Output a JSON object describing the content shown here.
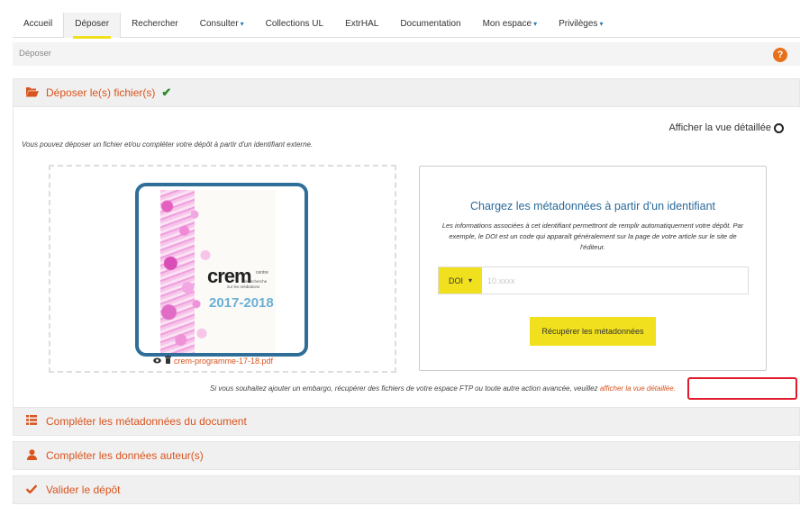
{
  "nav": {
    "items": [
      {
        "label": "Accueil",
        "dropdown": false,
        "active": false
      },
      {
        "label": "Déposer",
        "dropdown": false,
        "active": true
      },
      {
        "label": "Rechercher",
        "dropdown": false,
        "active": false
      },
      {
        "label": "Consulter",
        "dropdown": true,
        "active": false
      },
      {
        "label": "Collections UL",
        "dropdown": false,
        "active": false
      },
      {
        "label": "ExtrHAL",
        "dropdown": false,
        "active": false
      },
      {
        "label": "Documentation",
        "dropdown": false,
        "active": false
      },
      {
        "label": "Mon espace",
        "dropdown": true,
        "active": false
      },
      {
        "label": "Privilèges",
        "dropdown": true,
        "active": false
      }
    ],
    "caret": "▾"
  },
  "breadcrumb": {
    "label": "Déposer",
    "help": "?"
  },
  "deposit_section": {
    "title": "Déposer le(s) fichier(s)",
    "icon": "folder-open-icon",
    "check": "✔",
    "detail_toggle": "Afficher la vue détaillée",
    "intro": "Vous pouvez déposer un fichier et/ou compléter votre dépôt à partir d'un identifiant externe.",
    "file": {
      "name": "crem-programme-17-18.pdf",
      "cover_title": "crem",
      "cover_sub1": "centre",
      "cover_sub2": "de recherche",
      "cover_sub3": "sur les médiations",
      "cover_years": "2017-2018"
    },
    "metadata": {
      "title": "Chargez les métadonnées à partir d'un identifiant",
      "description": "Les informations associées à cet identifiant permettront de remplir automatiquement votre dépôt. Par exemple, le DOI est un code qui apparaît généralement sur la page de votre article sur le site de l'éditeur.",
      "id_type": "DOI",
      "placeholder": "10.xxxx",
      "fetch_button": "Récupérer les métadonnées"
    },
    "advanced_text": "Si vous souhaitez ajouter un embargo, récupérer des fichiers de votre espace FTP ou toute autre action avancée, veuillez",
    "advanced_link": "afficher la vue détaillée."
  },
  "sections": [
    {
      "title": "Compléter les métadonnées du document",
      "icon": "list-icon"
    },
    {
      "title": "Compléter les données auteur(s)",
      "icon": "user-icon"
    },
    {
      "title": "Valider le dépôt",
      "icon": "check-icon"
    }
  ],
  "colors": {
    "accent": "#d9541e",
    "highlight": "#f0e01e",
    "title_blue": "#2a6a9a",
    "frame_blue": "#2e6e99",
    "annotation_red": "#e01c2c"
  }
}
